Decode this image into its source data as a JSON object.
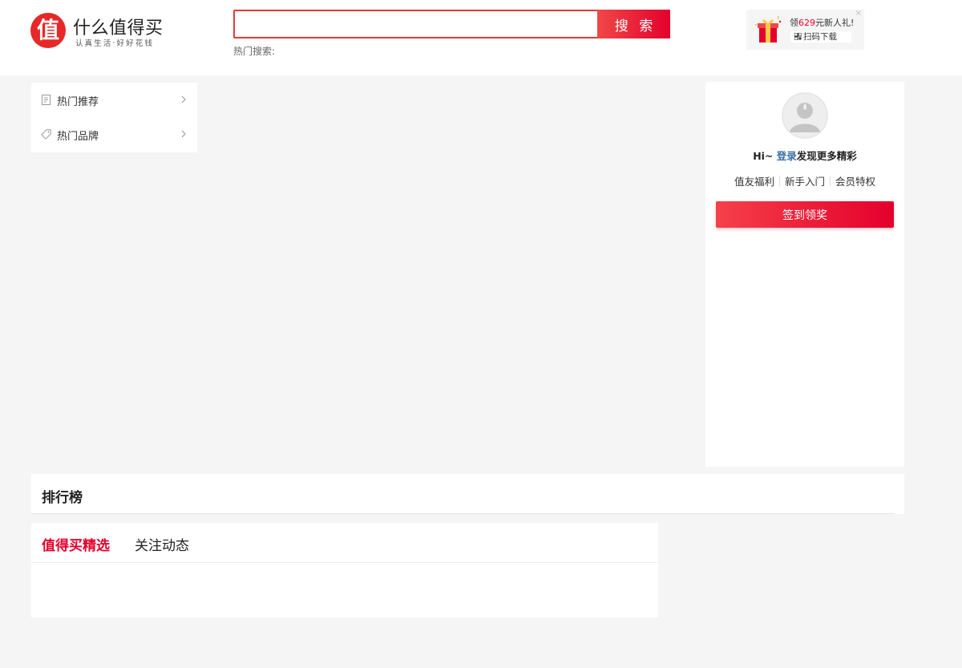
{
  "header": {
    "logo_mark": "值",
    "logo_name": "什么值得买",
    "logo_slogan": "认真生活·好好花钱",
    "search": {
      "placeholder": "",
      "button_label": "搜 索"
    },
    "hot_search_label": "热门搜索:",
    "promo": {
      "line1_prefix": "领",
      "line1_amount": "629",
      "line1_suffix": "元新人礼!",
      "line2": "扫码下载",
      "close": "×"
    }
  },
  "category_menu": {
    "items": [
      {
        "label": "热门推荐",
        "icon": "document-icon"
      },
      {
        "label": "热门品牌",
        "icon": "tag-icon"
      }
    ]
  },
  "user_panel": {
    "greeting_prefix": "Hi~ ",
    "login_link": "登录",
    "greeting_suffix": "发现更多精彩",
    "links": [
      {
        "label": "值友福利",
        "highlight": false
      },
      {
        "label": "新手入门",
        "highlight": false
      },
      {
        "label": "会员特权",
        "highlight": true
      }
    ],
    "signin_button": "签到领奖"
  },
  "ranking": {
    "title": "排行榜"
  },
  "feed": {
    "tabs": [
      {
        "label": "值得买精选",
        "active": true
      },
      {
        "label": "关注动态",
        "active": false
      }
    ]
  },
  "colors": {
    "brand_red": "#e4002b",
    "link_blue": "#3a6ea5",
    "page_bg": "#f5f5f5"
  }
}
